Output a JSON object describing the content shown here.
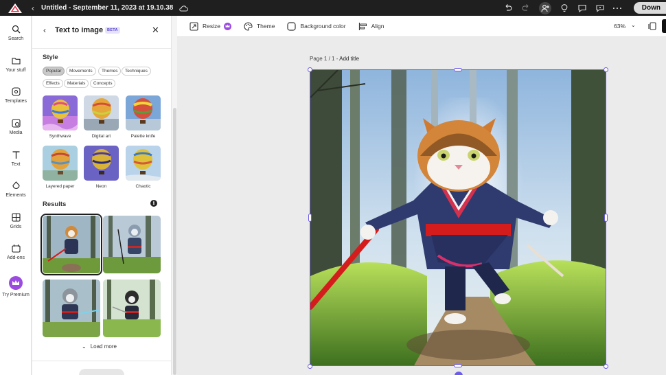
{
  "topbar": {
    "doc_title": "Untitled - September 11, 2023 at 19.10.38",
    "download_label": "Down"
  },
  "rail": {
    "items": [
      {
        "label": "Search",
        "icon": "search-icon"
      },
      {
        "label": "Your stuff",
        "icon": "folder-icon"
      },
      {
        "label": "Templates",
        "icon": "templates-icon"
      },
      {
        "label": "Media",
        "icon": "media-icon"
      },
      {
        "label": "Text",
        "icon": "text-icon"
      },
      {
        "label": "Elements",
        "icon": "elements-icon"
      },
      {
        "label": "Grids",
        "icon": "grids-icon"
      },
      {
        "label": "Add-ons",
        "icon": "addons-icon"
      },
      {
        "label": "Try Premium",
        "icon": "crown-icon"
      }
    ]
  },
  "panel": {
    "title": "Text to image",
    "badge": "BETA",
    "style_heading": "Style",
    "chips": [
      "Popular",
      "Movements",
      "Themes",
      "Techniques",
      "Effects",
      "Materials",
      "Concepts"
    ],
    "selected_chip": "Popular",
    "styles": [
      "Synthwave",
      "Digital art",
      "Palette knife",
      "Layered paper",
      "Neon",
      "Chaotic"
    ],
    "results_heading": "Results",
    "load_more_label": "Load more"
  },
  "toolbar": {
    "resize_label": "Resize",
    "theme_label": "Theme",
    "background_label": "Background color",
    "align_label": "Align",
    "zoom": "63%"
  },
  "canvas": {
    "page_label": "Page 1 / 1 - ",
    "page_title_placeholder": "Add title"
  },
  "colors": {
    "accent": "#6d5ce8",
    "premium": "#9b4be0",
    "topbar": "#1f1f1f"
  }
}
